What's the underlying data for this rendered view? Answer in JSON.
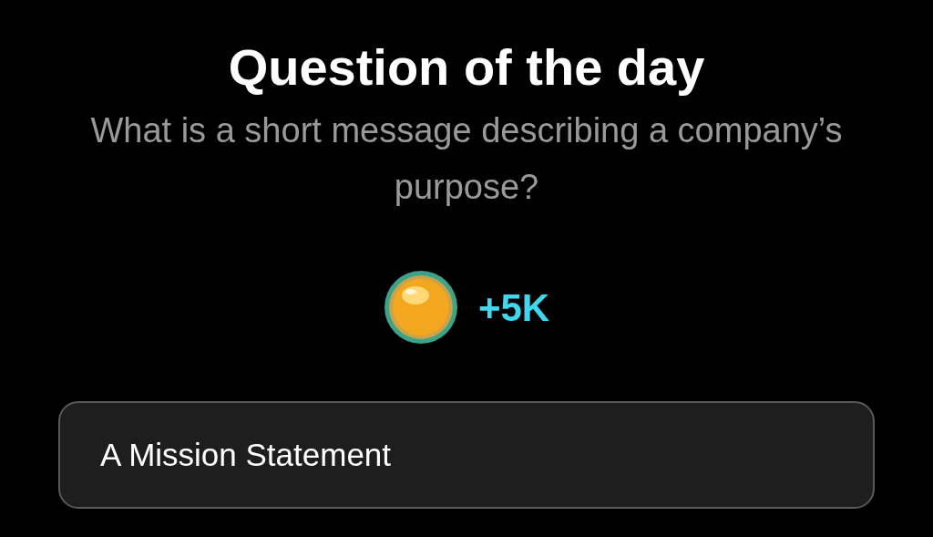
{
  "title": "Question of the day",
  "question": "What is a short message describing a company’s purpose?",
  "reward": {
    "amount": "+5K"
  },
  "answers": [
    {
      "label": "A Mission Statement"
    }
  ]
}
